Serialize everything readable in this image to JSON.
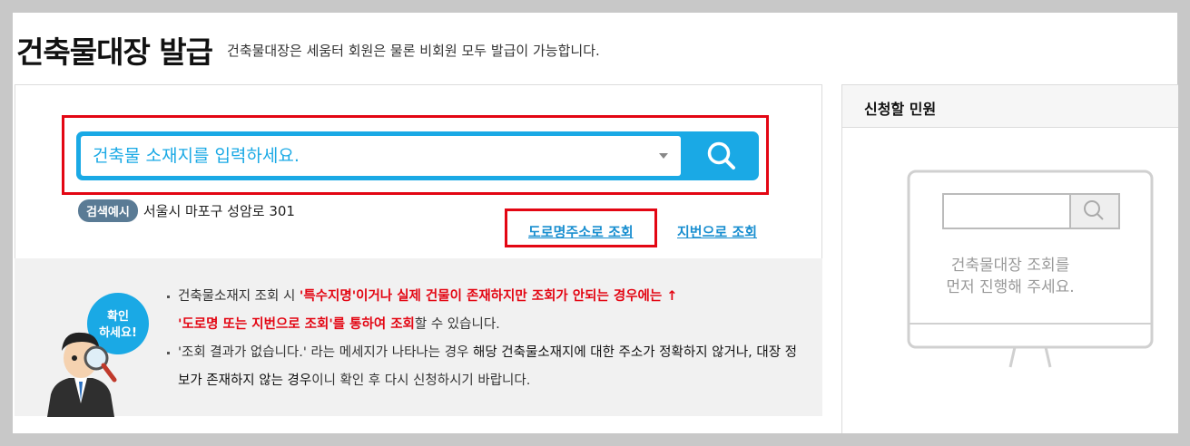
{
  "header": {
    "title": "건축물대장 발급",
    "subtitle": "건축물대장은 세움터 회원은 물론 비회원 모두 발급이 가능합니다."
  },
  "search": {
    "placeholder": "건축물 소재지를 입력하세요.",
    "value": "",
    "button_icon": "search-icon",
    "example_badge": "검색예시",
    "example_text": "서울시 마포구 성암로 301"
  },
  "lookup": {
    "road_label": "도로명주소로 조회",
    "jibun_label": "지번으로 조회"
  },
  "notice": {
    "mascot_bubble_line1": "확인",
    "mascot_bubble_line2": "하세요!",
    "item1_a": "건축물소재지 조회 시 ",
    "item1_b": "'특수지명'이거나 실제 건물이 존재하지만 조회가 안되는 경우에는 ↑",
    "item1_c": "'도로명 또는 지번으로 조회'를 통하여 조회",
    "item1_d": "할 수 있습니다.",
    "item2_a": "'조회 결과가 없습니다.' 라는 메세지가 나타나는 경우 ",
    "item2_b": "해당 건축물소재지에 대한 주소가 정확하지 않거나, 대장 정보가 존재하지 않는 경우",
    "item2_c": "이니 확인 후 다시 신청하시기 바랍니다."
  },
  "side": {
    "title": "신청할 민원",
    "message_line1": "건축물대장 조회를",
    "message_line2": "먼저 진행해 주세요."
  },
  "colors": {
    "accent": "#1aa9e5",
    "highlight": "#e30613",
    "link": "#1a8fd0",
    "badge": "#5a7b95"
  }
}
